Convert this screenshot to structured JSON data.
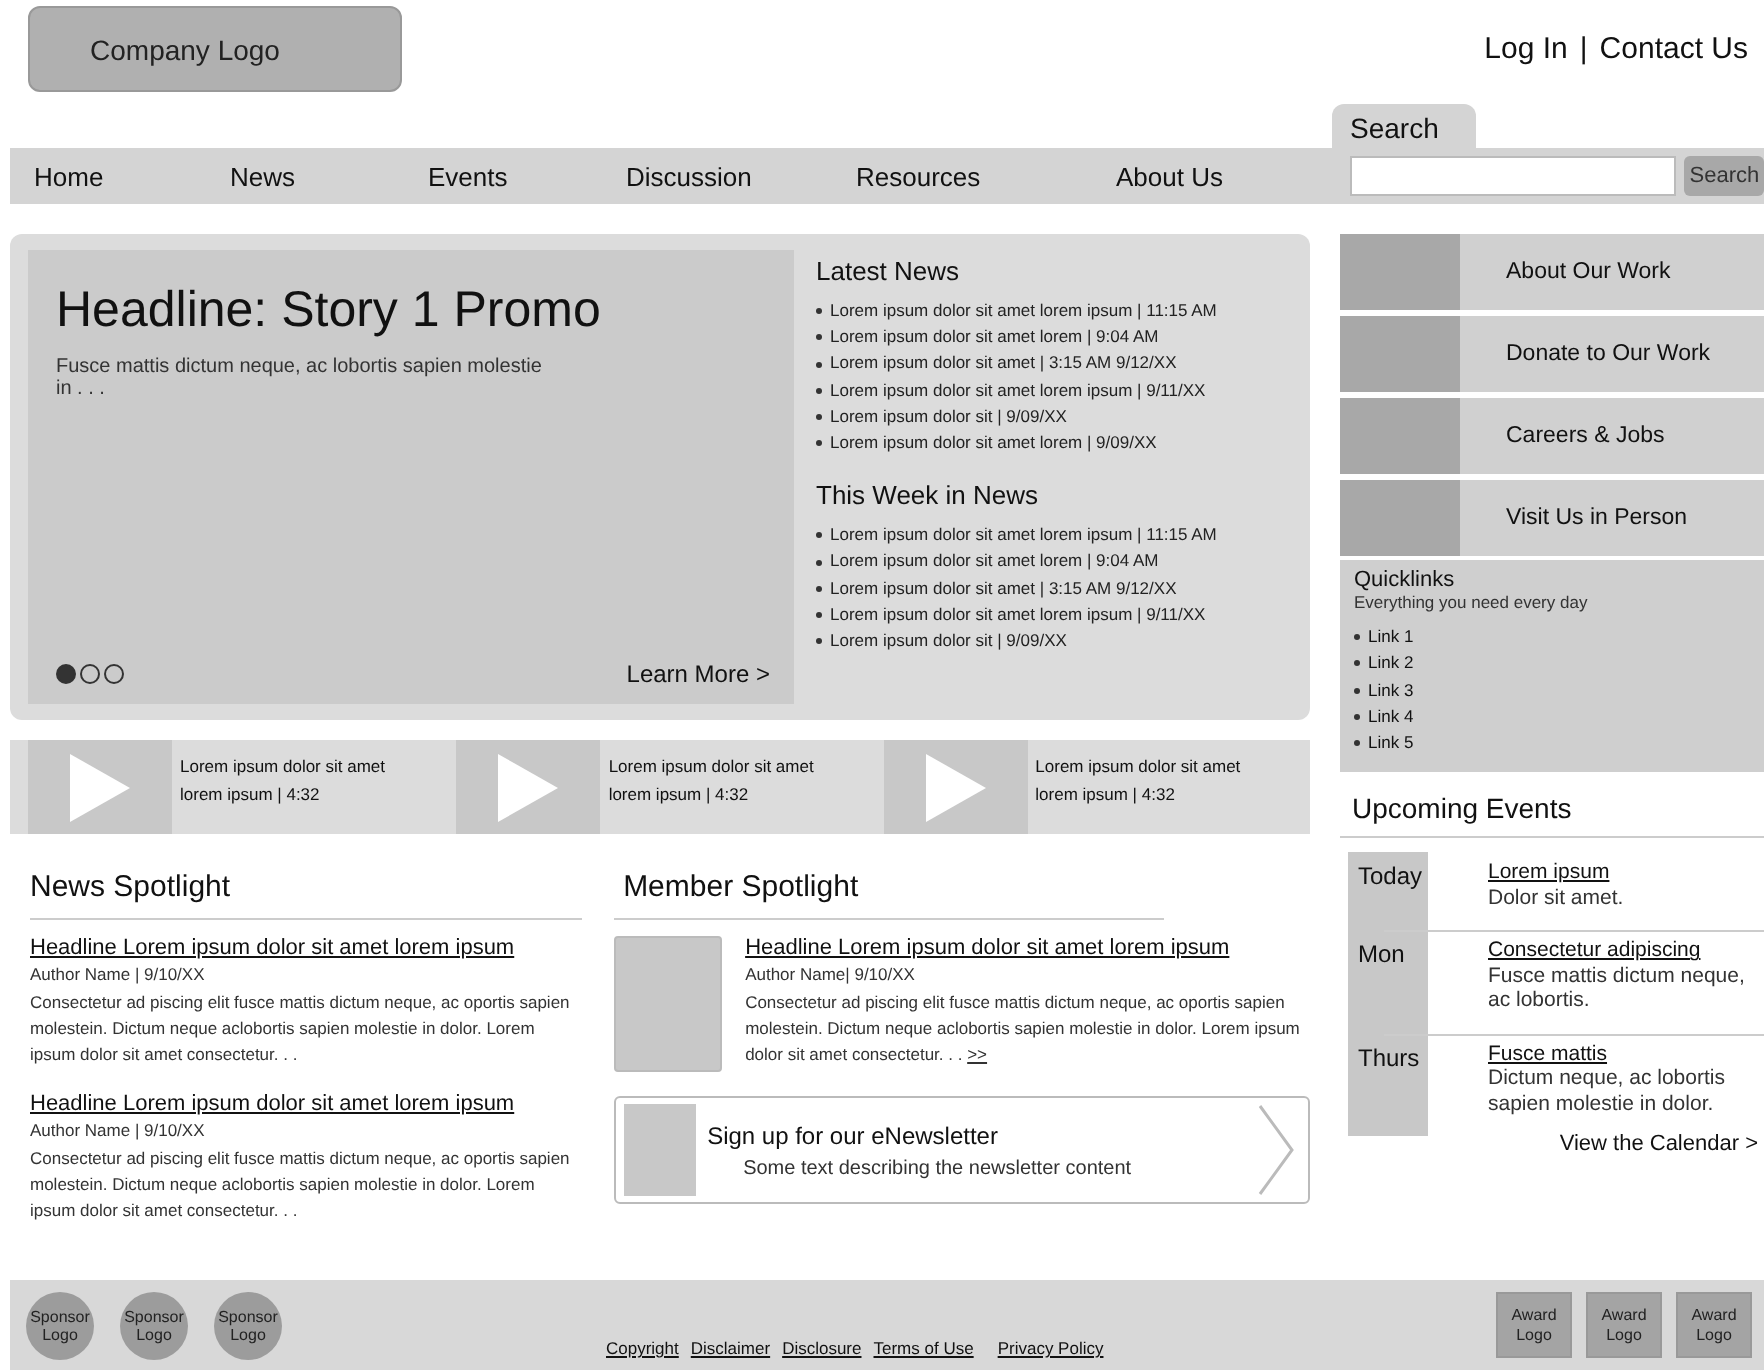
{
  "header": {
    "logo": "Company Logo",
    "links": [
      "Log In",
      "Contact Us"
    ],
    "separator": "|"
  },
  "search": {
    "tab": "Search",
    "button": "Search"
  },
  "nav": [
    "Home",
    "News",
    "Events",
    "Discussion",
    "Resources",
    "About Us"
  ],
  "promo": {
    "headline": "Headline: Story 1 Promo",
    "summary": "Fusce mattis dictum neque, ac lobortis sapien molestie in . . .",
    "learn_more": "Learn More >",
    "slides": [
      {
        "selected": true
      },
      {
        "selected": false
      },
      {
        "selected": false
      }
    ]
  },
  "news_lists": [
    {
      "title": "Latest News",
      "items": [
        "Lorem ipsum dolor sit amet lorem ipsum | 11:15 AM",
        "Lorem ipsum dolor sit amet lorem | 9:04 AM",
        "Lorem ipsum dolor sit amet | 3:15 AM 9/12/XX",
        "Lorem ipsum dolor sit amet lorem ipsum | 9/11/XX",
        "Lorem ipsum dolor sit | 9/09/XX",
        "Lorem ipsum dolor sit amet lorem | 9/09/XX"
      ]
    },
    {
      "title": "This Week in News",
      "items": [
        "Lorem ipsum dolor sit amet lorem ipsum | 11:15 AM",
        "Lorem ipsum dolor sit amet lorem | 9:04 AM",
        "Lorem ipsum dolor sit amet | 3:15 AM 9/12/XX",
        "Lorem ipsum dolor sit amet lorem ipsum | 9/11/XX",
        "Lorem ipsum dolor sit | 9/09/XX"
      ]
    }
  ],
  "videos": [
    {
      "line1": "Lorem ipsum dolor sit amet",
      "line2": "lorem ipsum | 4:32"
    },
    {
      "line1": "Lorem ipsum dolor sit amet",
      "line2": "lorem ipsum | 4:32"
    },
    {
      "line1": "Lorem ipsum dolor sit amet",
      "line2": "lorem ipsum | 4:32"
    }
  ],
  "news_spotlight": {
    "title": "News Spotlight",
    "articles": [
      {
        "headline": "Headline Lorem ipsum dolor sit amet lorem ipsum",
        "byline": "Author Name | 9/10/XX",
        "body": "Consectetur ad piscing elit fusce mattis dictum neque, ac oportis sapien molestein. Dictum neque aclobortis sapien molestie in dolor. Lorem ipsum dolor sit amet consectetur. . ."
      },
      {
        "headline": "Headline Lorem ipsum dolor sit amet lorem ipsum",
        "byline": "Author Name | 9/10/XX",
        "body": "Consectetur ad piscing elit fusce mattis dictum neque, ac oportis sapien molestein. Dictum neque aclobortis sapien molestie in dolor. Lorem ipsum dolor sit amet consectetur. . ."
      }
    ]
  },
  "member_spotlight": {
    "title": "Member Spotlight",
    "headline": "Headline Lorem ipsum dolor sit amet lorem ipsum",
    "byline": "Author Name| 9/10/XX",
    "body": "Consectetur ad piscing elit fusce mattis dictum neque, ac oportis sapien molestein. Dictum neque aclobortis sapien molestie in dolor. Lorem ipsum dolor sit amet consectetur. . .",
    "more": ">>"
  },
  "newsletter": {
    "title": "Sign up for our eNewsletter",
    "text": "Some text describing the newsletter content"
  },
  "tiles": [
    "About Our Work",
    "Donate to Our Work",
    "Careers & Jobs",
    "Visit Us in Person"
  ],
  "quicklinks": {
    "title": "Quicklinks",
    "subtitle": "Everything you need every day",
    "links": [
      "Link 1",
      "Link 2",
      "Link 3",
      "Link 4",
      "Link 5"
    ]
  },
  "events": {
    "title": "Upcoming Events",
    "items": [
      {
        "day": "Today",
        "title": "Lorem ipsum",
        "text": "Dolor sit amet."
      },
      {
        "day": "Mon",
        "title": "Consectetur adipiscing",
        "text": "Fusce mattis dictum neque, ac lobortis."
      },
      {
        "day": "Thurs",
        "title": "Fusce mattis",
        "text": "Dictum neque, ac lobortis sapien molestie in dolor."
      }
    ],
    "calendar": "View the Calendar >"
  },
  "footer": {
    "sponsors": [
      "Sponsor Logo",
      "Sponsor Logo",
      "Sponsor Logo"
    ],
    "links": [
      "Copyright",
      "Disclaimer",
      "Disclosure",
      "Terms of Use",
      "Privacy Policy"
    ],
    "awards": [
      "Award Logo",
      "Award Logo",
      "Award Logo"
    ]
  }
}
